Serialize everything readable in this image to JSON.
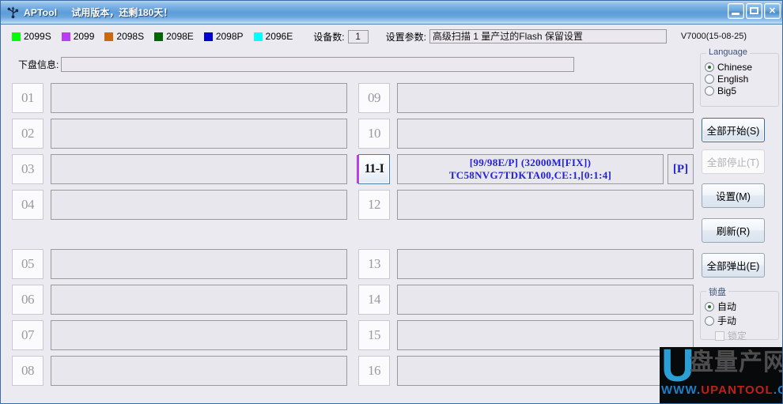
{
  "window": {
    "icon": "usb-icon",
    "title": "APTool",
    "trial_notice": "试用版本，还剩180天！",
    "minimize_label": "",
    "maximize_label": "",
    "close_label": "✕"
  },
  "toolbar": {
    "legend": [
      {
        "label": "2099S",
        "color": "#00ff00"
      },
      {
        "label": "2099",
        "color": "#b83ef0"
      },
      {
        "label": "2098S",
        "color": "#c96a12"
      },
      {
        "label": "2098E",
        "color": "#006600"
      },
      {
        "label": "2098P",
        "color": "#0000cc"
      },
      {
        "label": "2096E",
        "color": "#00ffff"
      }
    ],
    "device_count_label": "设备数:",
    "device_count_value": "1",
    "param_label": "设置参数:",
    "param_value": "高级扫描 1 量产过的Flash 保留设置",
    "version": "V7000(15-08-25)"
  },
  "info": {
    "label": "下盘信息:",
    "value": ""
  },
  "ports": {
    "left": [
      {
        "num": "01",
        "active": false,
        "line1": "",
        "line2": "",
        "badge": "",
        "stripe": ""
      },
      {
        "num": "02",
        "active": false,
        "line1": "",
        "line2": "",
        "badge": "",
        "stripe": ""
      },
      {
        "num": "03",
        "active": false,
        "line1": "",
        "line2": "",
        "badge": "",
        "stripe": ""
      },
      {
        "num": "04",
        "active": false,
        "line1": "",
        "line2": "",
        "badge": "",
        "stripe": ""
      },
      {
        "num": "05",
        "active": false,
        "line1": "",
        "line2": "",
        "badge": "",
        "stripe": ""
      },
      {
        "num": "06",
        "active": false,
        "line1": "",
        "line2": "",
        "badge": "",
        "stripe": ""
      },
      {
        "num": "07",
        "active": false,
        "line1": "",
        "line2": "",
        "badge": "",
        "stripe": ""
      },
      {
        "num": "08",
        "active": false,
        "line1": "",
        "line2": "",
        "badge": "",
        "stripe": ""
      }
    ],
    "right": [
      {
        "num": "09",
        "active": false,
        "line1": "",
        "line2": "",
        "badge": "",
        "stripe": ""
      },
      {
        "num": "10",
        "active": false,
        "line1": "",
        "line2": "",
        "badge": "",
        "stripe": ""
      },
      {
        "num": "11-I",
        "active": true,
        "line1": "[99/98E/P]  (32000M[FIX])",
        "line2": "TC58NVG7TDKTA00,CE:1,[0:1:4]",
        "badge": "[P]",
        "stripe": "#b83ef0"
      },
      {
        "num": "12",
        "active": false,
        "line1": "",
        "line2": "",
        "badge": "",
        "stripe": ""
      },
      {
        "num": "13",
        "active": false,
        "line1": "",
        "line2": "",
        "badge": "",
        "stripe": ""
      },
      {
        "num": "14",
        "active": false,
        "line1": "",
        "line2": "",
        "badge": "",
        "stripe": ""
      },
      {
        "num": "15",
        "active": false,
        "line1": "",
        "line2": "",
        "badge": "",
        "stripe": ""
      },
      {
        "num": "16",
        "active": false,
        "line1": "",
        "line2": "",
        "badge": "",
        "stripe": ""
      }
    ]
  },
  "sidebar": {
    "language": {
      "title": "Language",
      "options": [
        {
          "label": "Chinese",
          "selected": true
        },
        {
          "label": "English",
          "selected": false
        },
        {
          "label": "Big5",
          "selected": false
        }
      ]
    },
    "buttons": [
      {
        "label": "全部开始(S)",
        "state": "focused"
      },
      {
        "label": "全部停止(T)",
        "state": "disabled"
      },
      {
        "label": "设置(M)",
        "state": "normal"
      },
      {
        "label": "刷新(R)",
        "state": "normal"
      },
      {
        "label": "全部弹出(E)",
        "state": "normal"
      }
    ],
    "lock": {
      "title": "锁盘",
      "options": [
        {
          "label": "自动",
          "selected": true
        },
        {
          "label": "手动",
          "selected": false
        }
      ],
      "checkbox_label": "锁定",
      "checkbox_checked": false
    }
  },
  "watermark": {
    "logo_letter": "U",
    "logo_cn": "盘量产网",
    "url_prefix": "WWW.",
    "url_name": "UPANTOOL",
    "url_suffix": ".COM"
  }
}
